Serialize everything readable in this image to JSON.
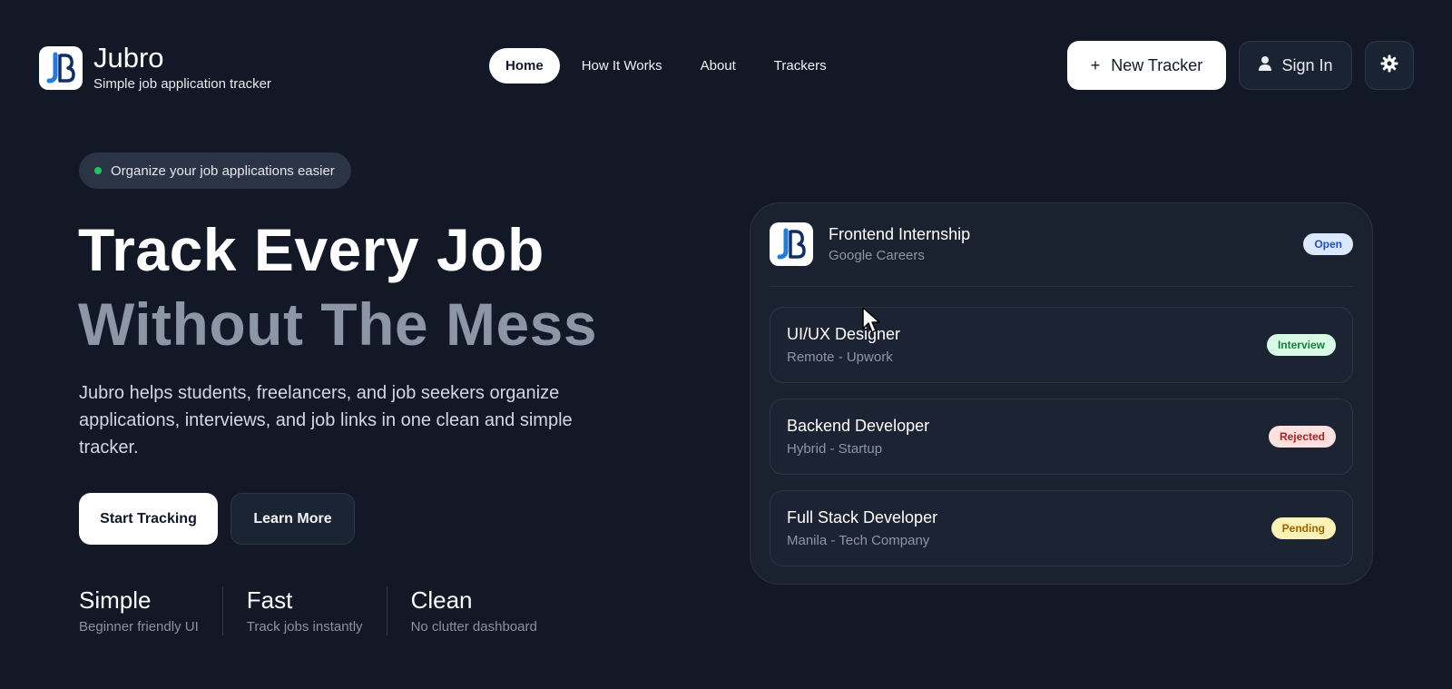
{
  "brand": {
    "name": "Jubro",
    "tagline": "Simple job application tracker"
  },
  "nav": {
    "items": [
      "Home",
      "How It Works",
      "About",
      "Trackers"
    ],
    "active": "Home"
  },
  "header_actions": {
    "new_tracker": "New Tracker",
    "new_tracker_icon": "+",
    "sign_in": "Sign In",
    "theme_icon": "gear-icon"
  },
  "hero": {
    "pill": "Organize your job applications easier",
    "title_line1": "Track Every Job",
    "title_line2": "Without The Mess",
    "description": "Jubro helps students, freelancers, and job seekers organize applications, interviews, and job links in one clean and simple tracker.",
    "cta_primary": "Start Tracking",
    "cta_secondary": "Learn More"
  },
  "stats": [
    {
      "title": "Simple",
      "sub": "Beginner friendly UI"
    },
    {
      "title": "Fast",
      "sub": "Track jobs instantly"
    },
    {
      "title": "Clean",
      "sub": "No clutter dashboard"
    }
  ],
  "card": {
    "featured": {
      "title": "Frontend Internship",
      "sub": "Google Careers",
      "status": "Open"
    },
    "jobs": [
      {
        "title": "UI/UX Designer",
        "sub": "Remote - Upwork",
        "status": "Interview"
      },
      {
        "title": "Backend Developer",
        "sub": "Hybrid - Startup",
        "status": "Rejected"
      },
      {
        "title": "Full Stack Developer",
        "sub": "Manila - Tech Company",
        "status": "Pending"
      }
    ]
  },
  "colors": {
    "background": "#121826",
    "accent_open": "#1d4ed8",
    "accent_interview": "#15803d",
    "accent_rejected": "#b91c1c",
    "accent_pending": "#a16207"
  }
}
